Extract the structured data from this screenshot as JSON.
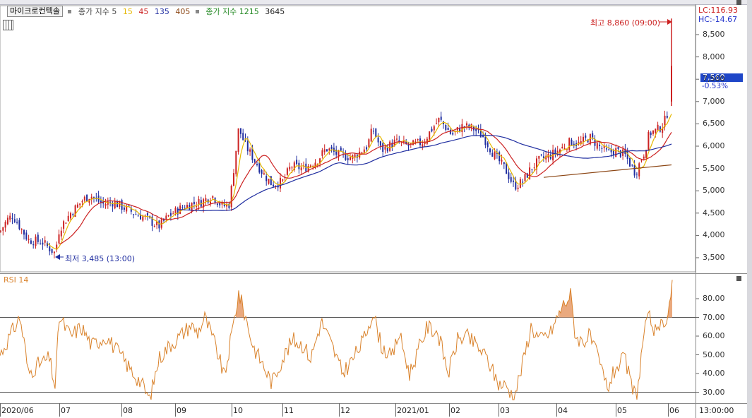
{
  "legend": {
    "symbol": "마이크로컨텍솔",
    "ma_label": "종가 지수 5",
    "ma_periods": [
      {
        "text": "15",
        "color": "#e6b800"
      },
      {
        "text": "45",
        "color": "#cc2222"
      },
      {
        "text": "135",
        "color": "#1f2da0"
      },
      {
        "text": "405",
        "color": "#8b4513"
      }
    ],
    "vol_label": "종가 지수 1215",
    "vol_extra": "3645"
  },
  "price_panel": {
    "lc": "LC:116.93",
    "hc": "HC:-14.67",
    "current_price": "7,560",
    "current_change": "-0.53%",
    "high_annotation": "최고 8,860 (09:00)",
    "low_annotation": "최저 3,485 (13:00)",
    "y_ticks": [
      "8,500",
      "8,000",
      "7,500",
      "7,000",
      "6,500",
      "6,000",
      "5,500",
      "5,000",
      "4,500",
      "4,000",
      "3,500"
    ]
  },
  "rsi_panel": {
    "label": "RSI 14",
    "y_ticks": [
      "80.00",
      "70.00",
      "60.00",
      "50.00",
      "40.00",
      "30.00"
    ],
    "overbought": 70,
    "oversold": 30
  },
  "x_axis": {
    "ticks": [
      "2020/06",
      "07",
      "08",
      "09",
      "10",
      "11",
      "12",
      "2021/01",
      "02",
      "03",
      "04",
      "05",
      "06"
    ],
    "time_label": "13:00:00"
  },
  "colors": {
    "candle_up": "#cc2222",
    "candle_down": "#1f2da0",
    "ma15": "#e6b800",
    "ma45": "#cc2222",
    "ma135": "#1f2da0",
    "ma405": "#8b4513",
    "rsi_line": "#d9822b",
    "rsi_fill": "#e8a070"
  },
  "chart_data": [
    {
      "type": "candlestick",
      "title": "마이크로컨텍솔",
      "x": [
        "2020/06",
        "07",
        "08",
        "09",
        "10",
        "11",
        "12",
        "2021/01",
        "02",
        "03",
        "04",
        "05",
        "06"
      ],
      "close_approx": [
        4200,
        4150,
        4550,
        4400,
        6200,
        5300,
        5700,
        6100,
        6600,
        5000,
        6000,
        5600,
        7560
      ],
      "ylim": [
        3300,
        8900
      ],
      "y_ticks": [
        3500,
        4000,
        4500,
        5000,
        5500,
        6000,
        6500,
        7000,
        7500,
        8000,
        8500
      ],
      "high": 8860,
      "low": 3485
    },
    {
      "type": "line",
      "title": "RSI 14",
      "x": [
        "2020/06",
        "07",
        "08",
        "09",
        "10",
        "11",
        "12",
        "2021/01",
        "02",
        "03",
        "04",
        "05",
        "06"
      ],
      "values": [
        45,
        62,
        52,
        35,
        82,
        55,
        60,
        58,
        62,
        28,
        78,
        30,
        88
      ],
      "ylim": [
        25,
        90
      ],
      "y_ticks": [
        30,
        40,
        50,
        60,
        70,
        80
      ]
    }
  ]
}
